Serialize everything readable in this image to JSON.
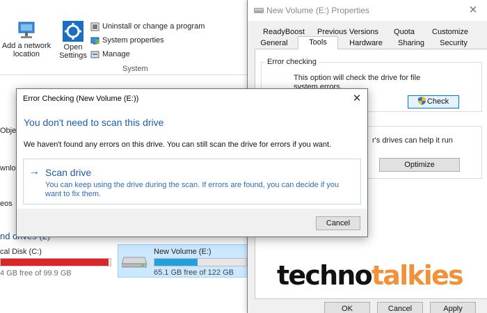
{
  "explorer": {
    "ribbon": {
      "add_network_location": "Add a network\nlocation",
      "open_settings": "Open\nSettings",
      "uninstall": "Uninstall or change a program",
      "system_properties": "System properties",
      "manage": "Manage",
      "group_label": "System"
    },
    "nav_items": [
      "Obje",
      "wnlo",
      "eos"
    ],
    "devices_header": "nd drives (2)",
    "drive_c": {
      "label": "cal Disk (C:)",
      "free": "4 GB free of 99.9 GB",
      "used_fraction": 0.98
    },
    "drive_e": {
      "label": "New Volume (E:)",
      "free": "65.1 GB free of 122 GB",
      "used_fraction": 0.47
    }
  },
  "properties": {
    "title": "New Volume (E:) Properties",
    "close_glyph": "✕",
    "tabs_row1": [
      "ReadyBoost",
      "Previous Versions",
      "Quota",
      "Customize"
    ],
    "tabs_row2": [
      "General",
      "Tools",
      "Hardware",
      "Sharing",
      "Security"
    ],
    "error_checking": {
      "legend": "Error checking",
      "text_line1": "This option will check the drive for file",
      "text_line2": "system errors.",
      "check_button": "Check"
    },
    "optimize": {
      "text": "r's drives can help it run",
      "button": "Optimize"
    },
    "footer": {
      "ok": "OK",
      "cancel": "Cancel",
      "apply": "Apply"
    }
  },
  "dialog": {
    "title": "Error Checking (New Volume (E:))",
    "close_glyph": "✕",
    "heading": "You don't need to scan this drive",
    "body": "We haven't found any errors on this drive. You can still scan the drive for errors if you want.",
    "scan_arrow": "→",
    "scan_title": "Scan drive",
    "scan_desc": "You can keep using the drive during the scan. If errors are found, you can decide if you want to fix them.",
    "cancel": "Cancel"
  },
  "watermark": {
    "part1": "techno",
    "part2": "talkies"
  },
  "colors": {
    "accent_blue": "#1e5aa8",
    "drive_c_fill": "#da2626",
    "drive_e_fill": "#26a0da",
    "watermark_orange": "#f2913b"
  }
}
